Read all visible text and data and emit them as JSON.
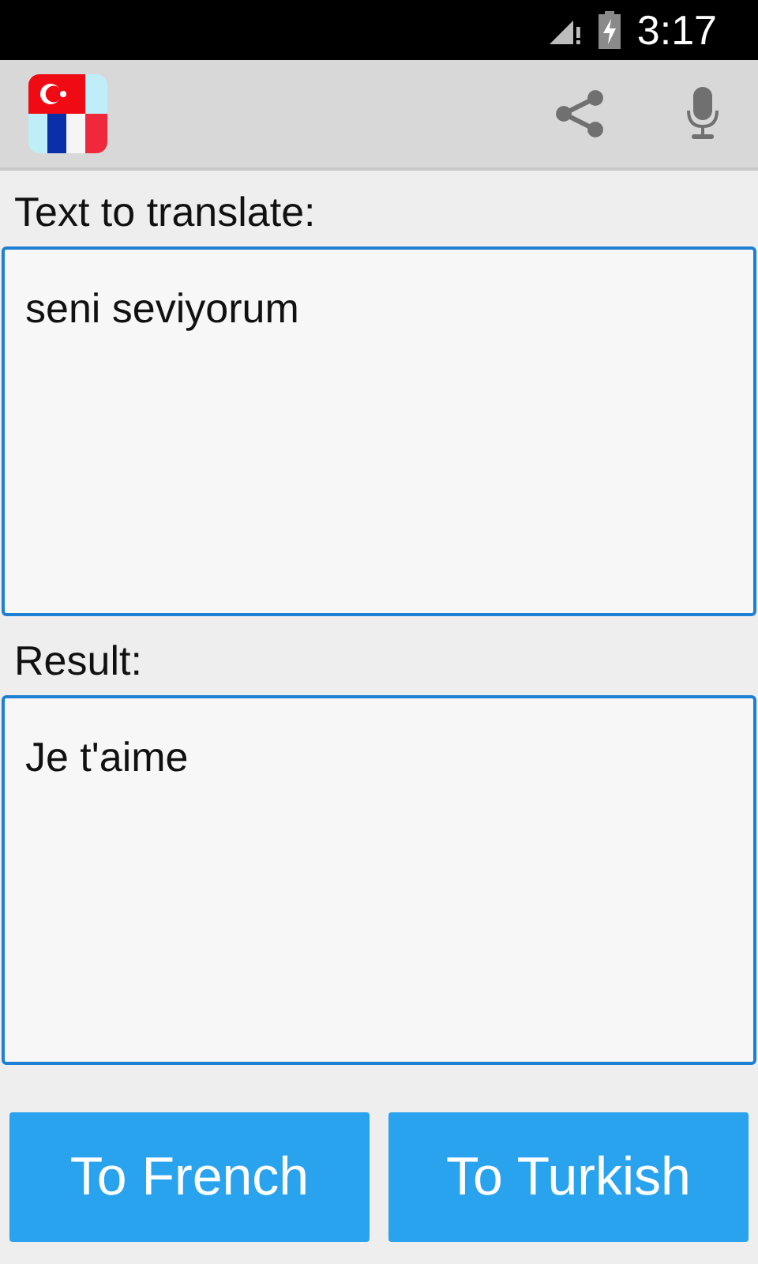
{
  "status_bar": {
    "time": "3:17"
  },
  "action_bar": {
    "actions": [
      {
        "kind": "share"
      },
      {
        "kind": "mic"
      }
    ]
  },
  "source": {
    "label": "Text to translate:",
    "value": "seni seviyorum"
  },
  "result": {
    "label": "Result:",
    "value": "Je t'aime"
  },
  "buttons": [
    {
      "label": "To French"
    },
    {
      "label": "To Turkish"
    }
  ]
}
